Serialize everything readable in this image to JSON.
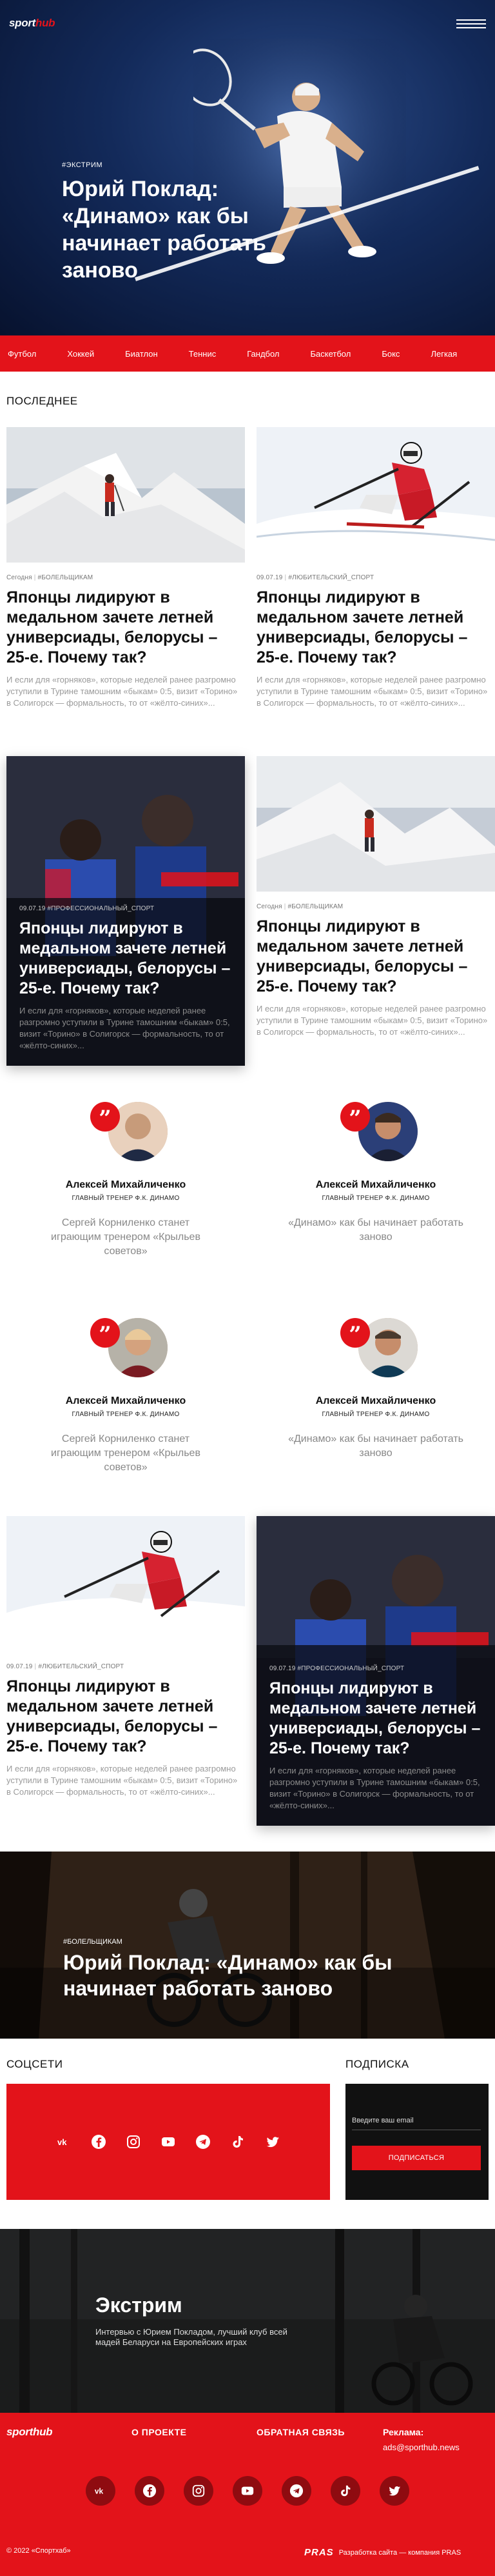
{
  "brand": {
    "logo_main": "sport",
    "logo_accent": "hub"
  },
  "hero": {
    "tag": "#ЭКСТРИМ",
    "title": "Юрий Поклад: «Динамо» как бы начинает работать заново"
  },
  "sports_nav": [
    "Футбол",
    "Хоккей",
    "Биатлон",
    "Теннис",
    "Гандбол",
    "Баскетбол",
    "Бокс",
    "Легкая"
  ],
  "latest": {
    "section_title": "ПОСЛЕДНЕЕ",
    "cards": [
      {
        "date": "Сегодня",
        "tag": "#БОЛЕЛЬЩИКАМ",
        "title": "Японцы лидируют в медальном зачете летней универсиады, белорусы – 25-е. Почему так?",
        "excerpt": "И если для «горняков», которые неделей ранее разгромно уступили в Турине тамошним «быкам» 0:5, визит «Торино» в Солигорск — формальность, то от «жёлто-синих»..."
      },
      {
        "date": "09.07.19",
        "tag": "#ЛЮБИТЕЛЬСКИЙ_СПОРТ",
        "title": "Японцы лидируют в медальном зачете летней универсиады, белорусы – 25-е. Почему так?",
        "excerpt": "И если для «горняков», которые неделей ранее разгромно уступили в Турине тамошним «быкам» 0:5, визит «Торино» в Солигорск — формальность, то от «жёлто-синих»..."
      },
      {
        "date": "09.07.19",
        "tag": "#ПРОФЕССИОНАЛЬНЫЙ_СПОРТ",
        "title": "Японцы лидируют в медальном зачете летней универсиады, белорусы – 25-е. Почему так?",
        "excerpt": "И если для «горняков», которые неделей ранее разгромно уступили в Турине тамошним «быкам» 0:5, визит «Торино» в Солигорск — формальность, то от «жёлто-синих»..."
      },
      {
        "date": "Сегодня",
        "tag": "#БОЛЕЛЬЩИКАМ",
        "title": "Японцы лидируют в медальном зачете летней универсиады, белорусы – 25-е. Почему так?",
        "excerpt": "И если для «горняков», которые неделей ранее разгромно уступили в Турине тамошним «быкам» 0:5, визит «Торино» в Солигорск — формальность, то от «жёлто-синих»..."
      },
      {
        "date": "09.07.19",
        "tag": "#ЛЮБИТЕЛЬСКИЙ_СПОРТ",
        "title": "Японцы лидируют в медальном зачете летней универсиады, белорусы – 25-е. Почему так?",
        "excerpt": "И если для «горняков», которые неделей ранее разгромно уступили в Турине тамошним «быкам» 0:5, визит «Торино» в Солигорск — формальность, то от «жёлто-синих»..."
      },
      {
        "date": "09.07.19",
        "tag": "#ПРОФЕССИОНАЛЬНЫЙ_СПОРТ",
        "title": "Японцы лидируют в медальном зачете летней универсиады, белорусы – 25-е. Почему так?",
        "excerpt": "И если для «горняков», которые неделей ранее разгромно уступили в Турине тамошним «быкам» 0:5, визит «Торино» в Солигорск — формальность, то от «жёлто-синих»..."
      }
    ]
  },
  "quotes": [
    {
      "name": "Алексей Михайличенко",
      "role": "ГЛАВНЫЙ ТРЕНЕР Ф.К. ДИНАМО",
      "text": "Сергей Корниленко станет играющим тренером «Крыльев советов»"
    },
    {
      "name": "Алексей Михайличенко",
      "role": "ГЛАВНЫЙ ТРЕНЕР Ф.К. ДИНАМО",
      "text": "«Динамо» как бы начинает работать заново"
    },
    {
      "name": "Алексей Михайличенко",
      "role": "ГЛАВНЫЙ ТРЕНЕР Ф.К. ДИНАМО",
      "text": "Сергей Корниленко станет играющим тренером «Крыльев советов»"
    },
    {
      "name": "Алексей Михайличенко",
      "role": "ГЛАВНЫЙ ТРЕНЕР Ф.К. ДИНАМО",
      "text": "«Динамо» как бы начинает работать заново"
    }
  ],
  "banner": {
    "tag": "#БОЛЕЛЬЩИКАМ",
    "title": "Юрий Поклад: «Динамо» как бы начинает работать заново"
  },
  "social": {
    "title": "СОЦСЕТИ",
    "icons": [
      "vk-icon",
      "facebook-icon",
      "instagram-icon",
      "youtube-icon",
      "telegram-icon",
      "tiktok-icon",
      "twitter-icon"
    ]
  },
  "subscribe": {
    "title": "ПОДПИСКА",
    "placeholder": "Введите ваш email",
    "button": "ПОДПИСАТЬСЯ"
  },
  "extreme": {
    "title": "Экстрим",
    "text": "Интервью с Юрием Покладом, лучший клуб всей мадей Беларуси на Европейских играх"
  },
  "footer": {
    "about": "О ПРОЕКТЕ",
    "feedback": "ОБРАТНАЯ СВЯЗЬ",
    "ad_label": "Реклама:",
    "ad_email": "ads@sporthub.news",
    "copyright": "© 2022 «Спортхаб»",
    "dev_logo": "PRAS",
    "dev_text": "Разработка сайта — компания PRAS"
  },
  "colors": {
    "accent": "#e3131a",
    "dark": "#111111",
    "footer_icon_bg": "#8f0b10"
  }
}
